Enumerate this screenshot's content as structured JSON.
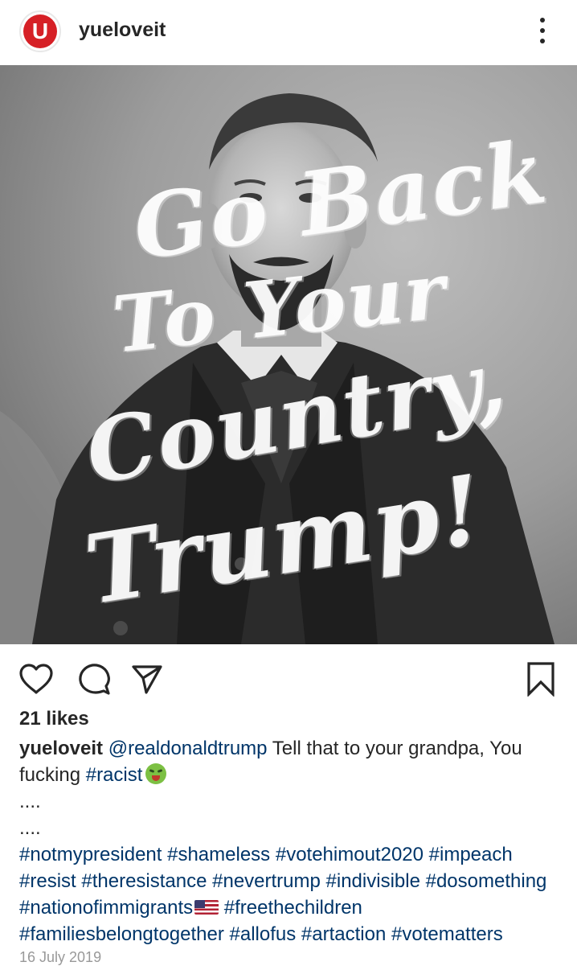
{
  "post": {
    "username": "yueloveit",
    "avatar_letter": "U",
    "icons": {
      "avatar": "brand-logo-icon",
      "more": "more-options-icon",
      "like": "heart-icon",
      "comment": "comment-icon",
      "share": "send-icon",
      "save": "bookmark-icon"
    },
    "colors": {
      "avatar_red": "#d62026",
      "link_blue": "#003569",
      "date_gray": "#999999"
    }
  },
  "image": {
    "overlay_lines": [
      "Go Back",
      "To Your",
      "Country,",
      "Trump!"
    ]
  },
  "engagement": {
    "likes": "21 likes"
  },
  "caption": {
    "username": "yueloveit",
    "mention": "@realdonaldtrump",
    "text": "Tell that to your grandpa, You fucking",
    "hashtag_racist": "#racist",
    "dots1": "....",
    "dots2": "....",
    "hashtags": {
      "notmypresident": "#notmypresident",
      "shameless": "#shameless",
      "votehimout2020": "#votehimout2020",
      "impeach": "#impeach",
      "resist": "#resist",
      "theresistance": "#theresistance",
      "nevertrump": "#nevertrump",
      "indivisible": "#indivisible",
      "dosomething": "#dosomething",
      "nationofimmigrants": "#nationofimmigrants",
      "freethechildren": "#freethechildren",
      "familiesbelongtogether": "#familiesbelongtogether",
      "allofus": "#allofus",
      "artaction": "#artaction",
      "votematters": "#votematters"
    }
  },
  "date": "16 July 2019"
}
